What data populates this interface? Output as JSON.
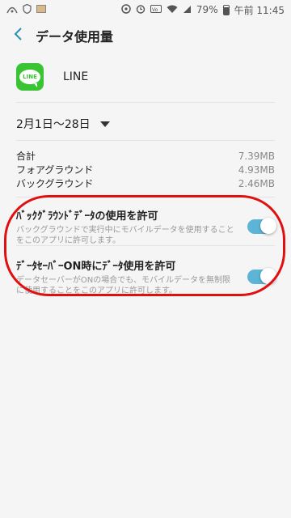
{
  "status_bar": {
    "left_icons": [
      "signal-icon",
      "shield-icon",
      "image-icon"
    ],
    "battery": "79%",
    "time": "午前 11:45"
  },
  "header": {
    "title": "データ使用量"
  },
  "app": {
    "name": "LINE",
    "logo_text": "LINE",
    "logo_color": "#3ac433"
  },
  "date_range": "2月1日〜28日",
  "usage": [
    {
      "label": "合計",
      "value": "7.39MB"
    },
    {
      "label": "フォアグラウンド",
      "value": "4.93MB"
    },
    {
      "label": "バックグラウンド",
      "value": "2.46MB"
    }
  ],
  "settings": [
    {
      "title": "ﾊﾞｯｸｸﾞﾗｳﾝﾄﾞﾃﾞｰﾀの使用を許可",
      "description": "バックグラウンドで実行中にモバイルデータを使用することをこのアプリに許可します。",
      "enabled": true
    },
    {
      "title": "ﾃﾞｰﾀｾｰﾊﾞｰON時にﾃﾞｰﾀ使用を許可",
      "description": "データセーバーがONの場合でも、モバイルデータを無制限に使用することをこのアプリに許可します。",
      "enabled": true
    }
  ],
  "colors": {
    "accent": "#5cb5d6",
    "highlight": "#e01010",
    "back_arrow": "#2d8fb0"
  }
}
